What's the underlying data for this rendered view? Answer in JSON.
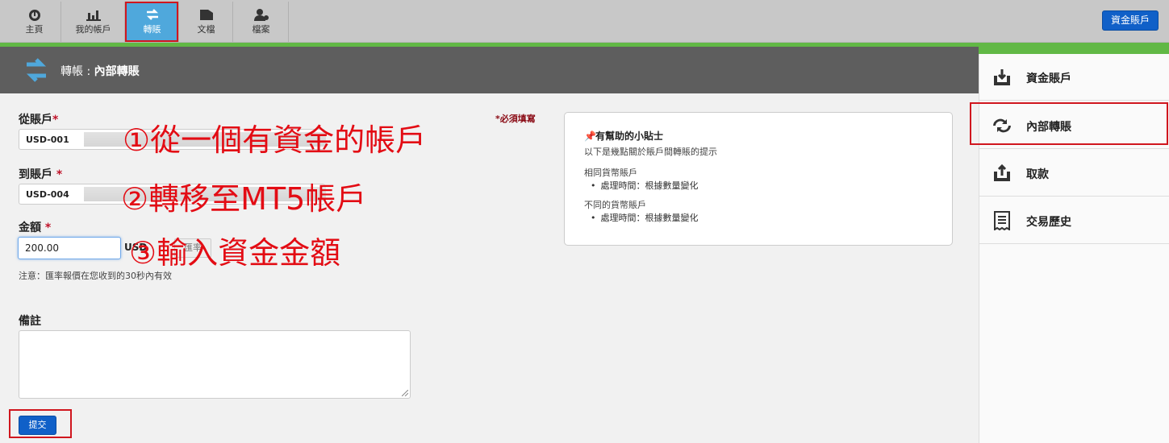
{
  "nav": {
    "tabs": [
      {
        "label": "主頁",
        "icon": "dashboard-icon"
      },
      {
        "label": "我的帳戶",
        "icon": "bar-chart-icon"
      },
      {
        "label": "轉賬",
        "icon": "transfer-arrows-icon"
      },
      {
        "label": "文檔",
        "icon": "folder-icon"
      },
      {
        "label": "檔案",
        "icon": "user-profile-icon"
      }
    ],
    "funding_button": "資金賬戶"
  },
  "header": {
    "section": "轉帳",
    "separator": " : ",
    "page": "內部轉賬"
  },
  "sidebar": {
    "items": [
      {
        "label": "資金賬戶",
        "icon": "deposit-icon"
      },
      {
        "label": "內部轉賬",
        "icon": "internal-transfer-icon"
      },
      {
        "label": "取款",
        "icon": "withdraw-icon"
      },
      {
        "label": "交易歷史",
        "icon": "history-icon"
      }
    ]
  },
  "form": {
    "from_label": "從賬戶",
    "to_label": "到賬戶",
    "amount_label": "金額",
    "required_star": "*",
    "required_note": "*必須填寫",
    "from_value": "USD-001",
    "to_value": "USD-004",
    "amount_value": "200.00",
    "currency": "USD",
    "rate_button": "匯率",
    "note": "注意：匯率報價在您收到的30秒內有效",
    "remarks_label": "備註",
    "submit": "提交"
  },
  "annotations": {
    "step1": "①從一個有資金的帳戶",
    "step2": "②轉移至MT5帳戶",
    "step3": "③輸入資金金額"
  },
  "tips": {
    "title": "有幫助的小貼士",
    "intro": "以下是幾點關於賬戶間轉賬的提示",
    "same_currency": "相同貨幣賬戶",
    "same_item": "處理時間：根據數量變化",
    "diff_currency": "不同的貨幣賬戶",
    "diff_item": "處理時間：根據數量變化"
  },
  "colors": {
    "accent_blue": "#1060c8",
    "active_tab": "#4fa8dc",
    "green": "#61b845",
    "annotation_red": "#e30c14"
  }
}
